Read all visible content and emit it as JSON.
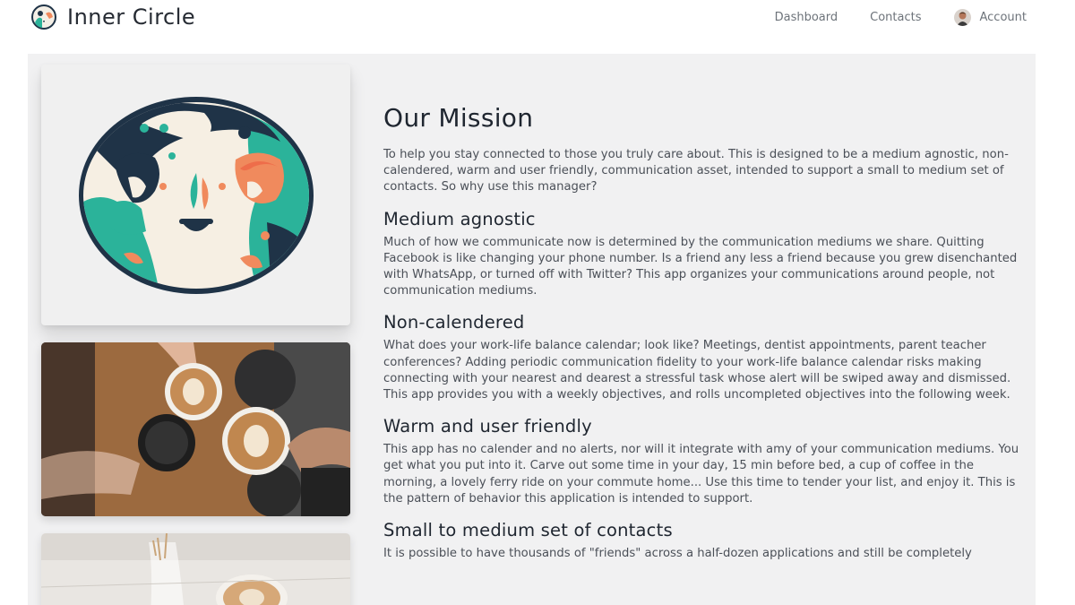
{
  "header": {
    "brand_name": "Inner Circle",
    "logo_icon": "globe-people-icon",
    "nav": [
      {
        "label": "Dashboard"
      },
      {
        "label": "Contacts"
      },
      {
        "label": "Account"
      }
    ]
  },
  "colors": {
    "teal": "#2bb39a",
    "navy": "#1f3347",
    "coral": "#f08a5d",
    "panel_bg": "#f1f1f2"
  },
  "mission": {
    "title": "Our Mission",
    "intro": "To help you stay connected to those you truly care about. This is designed to be a medium agnostic, non-calendered, warm and user friendly, communication asset, intended to support a small to medium set of contacts. So why use this manager?",
    "sections": [
      {
        "heading": "Medium agnostic",
        "body": "Much of how we communicate now is determined by the communication mediums we share. Quitting Facebook is like changing your phone number. Is a friend any less a friend because you grew disenchanted with WhatsApp, or turned off with Twitter? This app organizes your communications around people, not communication mediums."
      },
      {
        "heading": "Non-calendered",
        "body": "What does your work-life balance calendar; look like? Meetings, dentist appointments, parent teacher conferences? Adding periodic communication fidelity to your work-life balance calendar risks making connecting with your nearest and dearest a stressful task whose alert will be swiped away and dismissed. This app provides you with a weekly objectives, and rolls uncompleted objectives into the following week."
      },
      {
        "heading": "Warm and user friendly",
        "body": "This app has no calender and no alerts, nor will it integrate with amy of your communication mediums. You get what you put into it. Carve out some time in your day, 15 min before bed, a cup of coffee in the morning, a lovely ferry ride on your commute home... Use this time to tender your list, and enjoy it. This is the pattern of behavior this application is intended to support."
      },
      {
        "heading": "Small to medium set of contacts",
        "body": "It is possible to have thousands of \"friends\" across a half-dozen applications and still be completely"
      }
    ]
  }
}
